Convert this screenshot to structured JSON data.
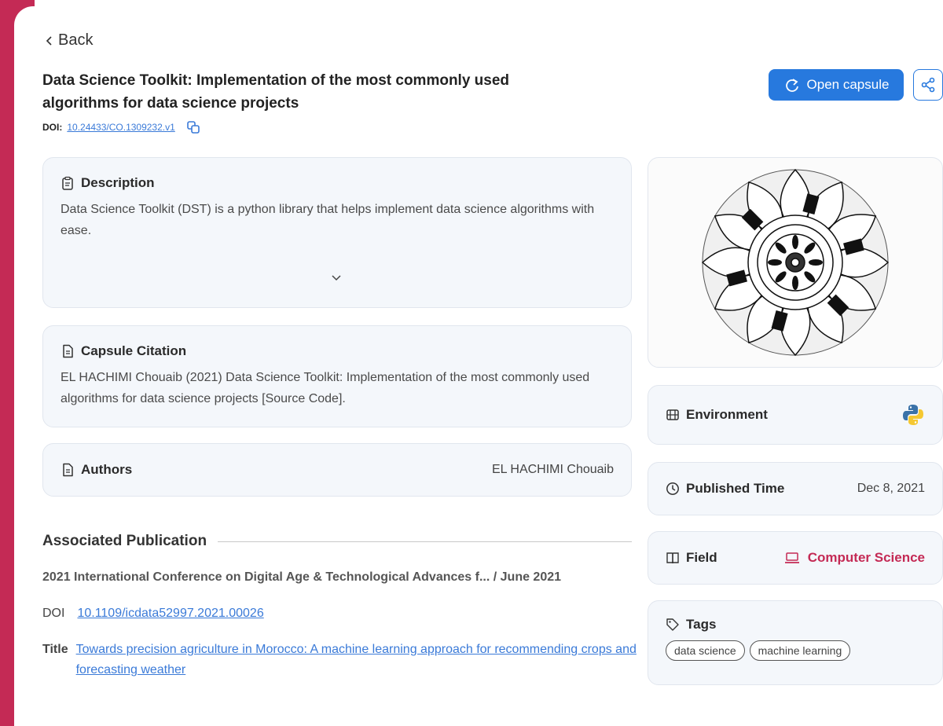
{
  "nav": {
    "back_label": "Back"
  },
  "header": {
    "title": "Data Science Toolkit: Implementation of the most commonly used algorithms for data science projects",
    "doi_label": "DOI:",
    "doi_value": "10.24433/CO.1309232.v1",
    "open_label": "Open capsule"
  },
  "description": {
    "heading": "Description",
    "text": "Data Science Toolkit (DST) is a python library that helps implement data science algorithms with ease."
  },
  "citation": {
    "heading": "Capsule Citation",
    "text": "EL HACHIMI Chouaib (2021) Data Science Toolkit: Implementation of the most commonly used algorithms for data science projects [Source Code]."
  },
  "authors": {
    "heading": "Authors",
    "value": "EL HACHIMI Chouaib"
  },
  "publication": {
    "heading": "Associated Publication",
    "venue": "2021 International Conference on Digital Age & Technological Advances f... / June 2021",
    "doi_label": "DOI",
    "doi_value": "10.1109/icdata52997.2021.00026",
    "title_label": "Title",
    "title_value": "Towards precision agriculture in Morocco: A machine learning approach for recommending crops and forecasting weather"
  },
  "sidebar": {
    "environment_label": "Environment",
    "environment_icon": "python-icon",
    "published_label": "Published Time",
    "published_value": "Dec 8, 2021",
    "field_label": "Field",
    "field_value": "Computer Science",
    "tags_label": "Tags",
    "tags": [
      "data science",
      "machine learning"
    ]
  },
  "colors": {
    "accent": "#c42a55",
    "primary": "#2779de",
    "link": "#3a7ad8"
  }
}
